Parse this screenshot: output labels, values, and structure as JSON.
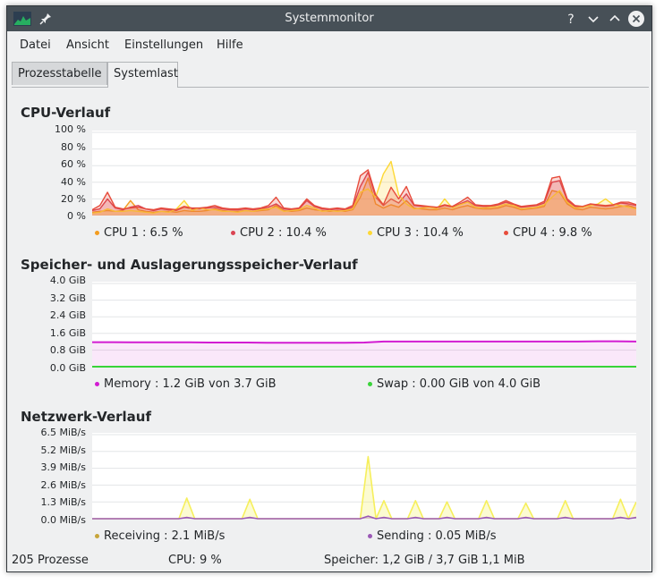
{
  "window": {
    "title": "Systemmonitor"
  },
  "menu": [
    "Datei",
    "Ansicht",
    "Einstellungen",
    "Hilfe"
  ],
  "tabs": [
    "Prozesstabelle",
    "Systemlast"
  ],
  "colors": {
    "cpu1": "#f39c1f",
    "cpu2": "#da4453",
    "cpu3": "#fdd835",
    "cpu4": "#e74c3c",
    "memory": "#d21bd2",
    "swap": "#3ad43a",
    "receiving": "#f6ef5c",
    "sending": "#9b59b6"
  },
  "cpu": {
    "title": "CPU-Verlauf",
    "y_ticks": [
      "100 %",
      "80 %",
      "60 %",
      "40 %",
      "20 %",
      "0 %"
    ],
    "legend": [
      "CPU 1 : 6.5 %",
      "CPU 2 : 10.4 %",
      "CPU 3 : 10.4 %",
      "CPU 4 : 9.8 %"
    ]
  },
  "mem": {
    "title": "Speicher- und Auslagerungsspeicher-Verlauf",
    "y_ticks": [
      "4.0 GiB",
      "3.2 GiB",
      "2.4 GiB",
      "1.6 GiB",
      "0.8 GiB",
      "0.0 GiB"
    ],
    "legend": [
      "Memory : 1.2 GiB von 3.7 GiB",
      "Swap : 0.00 GiB von 4.0 GiB"
    ]
  },
  "net": {
    "title": "Netzwerk-Verlauf",
    "y_ticks": [
      "6.5 MiB/s",
      "5.2 MiB/s",
      "3.9 MiB/s",
      "2.6 MiB/s",
      "1.3 MiB/s",
      "0.0 MiB/s"
    ],
    "legend": [
      "Receiving : 2.1 MiB/s",
      "Sending : 0.05 MiB/s"
    ]
  },
  "status": {
    "processes": "205 Prozesse",
    "cpu": "CPU: 9 %",
    "memory": "Speicher: 1,2 GiB / 3,7 GiB",
    "swap": "1,1 MiB"
  },
  "chart_data": [
    {
      "type": "area",
      "title": "CPU-Verlauf",
      "ylim": [
        0,
        100
      ],
      "series": [
        {
          "name": "CPU 1",
          "values": [
            4,
            5,
            6,
            5,
            6,
            18,
            7,
            5,
            4,
            5,
            5,
            4,
            6,
            5,
            5,
            6,
            8,
            6,
            5,
            5,
            6,
            5,
            6,
            7,
            12,
            6,
            5,
            6,
            9,
            7,
            6,
            5,
            6,
            5,
            7,
            22,
            45,
            14,
            9,
            13,
            10,
            18,
            9,
            8,
            7,
            7,
            9,
            7,
            10,
            12,
            9,
            8,
            8,
            9,
            12,
            10,
            7,
            8,
            9,
            11,
            30,
            28,
            14,
            8,
            7,
            10,
            9,
            8,
            9,
            11,
            12,
            9
          ]
        },
        {
          "name": "CPU 2",
          "values": [
            6,
            8,
            20,
            9,
            7,
            10,
            12,
            8,
            6,
            8,
            7,
            6,
            10,
            8,
            8,
            9,
            10,
            8,
            7,
            7,
            8,
            7,
            8,
            10,
            14,
            8,
            7,
            8,
            18,
            11,
            8,
            7,
            8,
            7,
            10,
            35,
            52,
            22,
            12,
            20,
            15,
            26,
            12,
            11,
            10,
            9,
            12,
            10,
            14,
            18,
            12,
            11,
            11,
            13,
            16,
            13,
            10,
            11,
            12,
            15,
            40,
            42,
            18,
            11,
            10,
            13,
            12,
            11,
            12,
            15,
            14,
            12
          ]
        },
        {
          "name": "CPU 3",
          "values": [
            3,
            4,
            8,
            5,
            5,
            6,
            5,
            4,
            3,
            5,
            4,
            8,
            18,
            6,
            9,
            7,
            7,
            5,
            5,
            4,
            6,
            5,
            7,
            8,
            10,
            5,
            6,
            7,
            12,
            9,
            5,
            6,
            5,
            6,
            8,
            28,
            32,
            22,
            50,
            65,
            25,
            14,
            8,
            9,
            10,
            8,
            20,
            9,
            13,
            16,
            10,
            9,
            10,
            11,
            14,
            12,
            8,
            9,
            10,
            13,
            22,
            30,
            16,
            9,
            10,
            12,
            14,
            20,
            13,
            12,
            10,
            8
          ]
        },
        {
          "name": "CPU 4",
          "values": [
            7,
            12,
            28,
            10,
            8,
            9,
            10,
            8,
            7,
            9,
            8,
            7,
            11,
            9,
            9,
            10,
            12,
            9,
            8,
            8,
            9,
            8,
            9,
            12,
            22,
            9,
            8,
            9,
            20,
            12,
            9,
            8,
            9,
            8,
            12,
            48,
            55,
            25,
            13,
            34,
            20,
            35,
            13,
            12,
            11,
            10,
            13,
            11,
            16,
            22,
            13,
            12,
            12,
            14,
            18,
            14,
            11,
            12,
            13,
            17,
            45,
            47,
            20,
            12,
            11,
            14,
            13,
            12,
            13,
            16,
            16,
            13
          ]
        }
      ]
    },
    {
      "type": "line",
      "title": "Speicher- und Auslagerungsspeicher-Verlauf",
      "ylim": [
        0,
        4.0
      ],
      "series": [
        {
          "name": "Memory",
          "values": [
            1.18,
            1.18,
            1.17,
            1.17,
            1.17,
            1.17,
            1.16,
            1.16,
            1.16,
            1.15,
            1.15,
            1.15,
            1.15,
            1.15,
            1.16,
            1.21,
            1.21,
            1.21,
            1.21,
            1.21,
            1.21,
            1.21,
            1.21,
            1.21,
            1.21,
            1.21,
            1.22,
            1.22,
            1.21
          ]
        },
        {
          "name": "Swap",
          "values": [
            0.0,
            0.0,
            0.0,
            0.0,
            0.0,
            0.0,
            0.0,
            0.0,
            0.0,
            0.0,
            0.0,
            0.0,
            0.0,
            0.0,
            0.0,
            0.0,
            0.0,
            0.0,
            0.0,
            0.0,
            0.0,
            0.0,
            0.0,
            0.0,
            0.0,
            0.0,
            0.0,
            0.0,
            0.0
          ]
        }
      ]
    },
    {
      "type": "area",
      "title": "Netzwerk-Verlauf",
      "ylim": [
        0,
        6.5
      ],
      "series": [
        {
          "name": "Receiving",
          "values": [
            0,
            0,
            0,
            0,
            0,
            0,
            0,
            0,
            0,
            0,
            0,
            0,
            1.6,
            0,
            0,
            0,
            0,
            0,
            0,
            0,
            1.5,
            0,
            0,
            0,
            0,
            0,
            0,
            0,
            0,
            0,
            0,
            0,
            0,
            0,
            0,
            4.8,
            0,
            1.4,
            0,
            0,
            0,
            1.4,
            0,
            0,
            0,
            1.3,
            0,
            0,
            0,
            0,
            1.4,
            0,
            0,
            0,
            0,
            1.2,
            0,
            0,
            0,
            0,
            1.4,
            0,
            0,
            0,
            0,
            0,
            0,
            1.5,
            0,
            1.3
          ]
        },
        {
          "name": "Sending",
          "values": [
            0,
            0,
            0,
            0,
            0,
            0,
            0,
            0,
            0,
            0,
            0,
            0,
            0.1,
            0,
            0,
            0,
            0,
            0,
            0,
            0,
            0.1,
            0,
            0,
            0,
            0,
            0,
            0,
            0,
            0,
            0,
            0,
            0,
            0,
            0,
            0,
            0.2,
            0,
            0.1,
            0,
            0,
            0,
            0.1,
            0,
            0,
            0,
            0.1,
            0,
            0,
            0,
            0,
            0.1,
            0,
            0,
            0,
            0,
            0.1,
            0,
            0,
            0,
            0,
            0.1,
            0,
            0,
            0,
            0,
            0,
            0,
            0.1,
            0,
            0.1
          ]
        }
      ]
    }
  ]
}
